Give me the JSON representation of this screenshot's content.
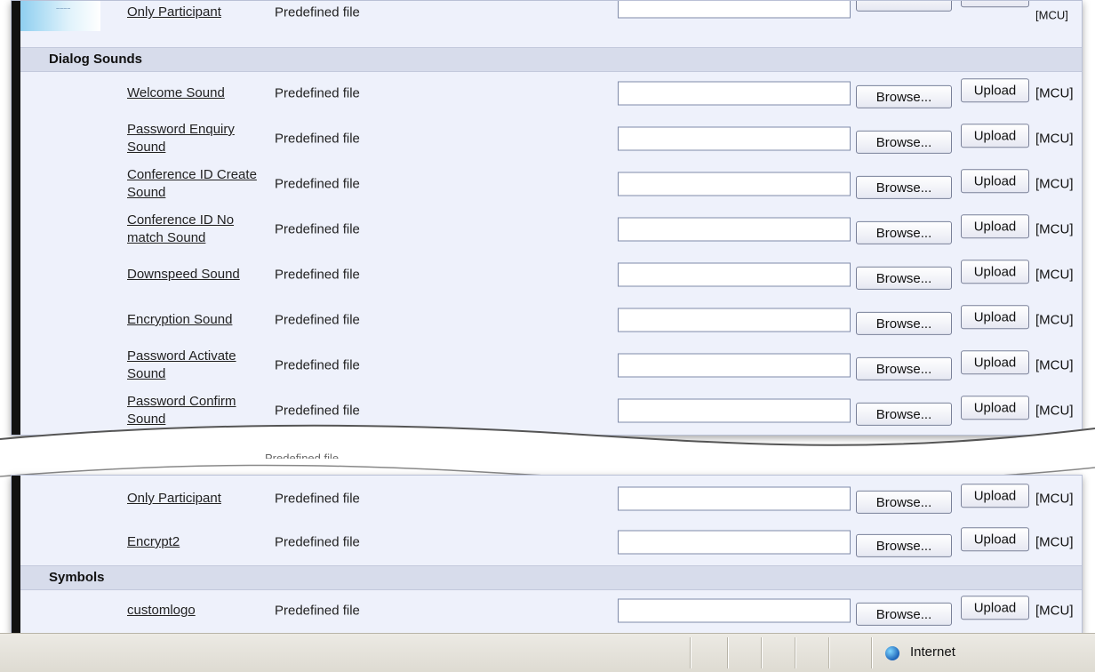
{
  "top_panel": {
    "partial_row": {
      "label": "Only Participant",
      "type": "Predefined file",
      "suffix": "[MCU]"
    },
    "section_title": "Dialog Sounds",
    "rows": [
      {
        "label": "Welcome Sound",
        "type": "Predefined file",
        "browse": "Browse...",
        "upload": "Upload",
        "suffix": "[MCU]"
      },
      {
        "label": "Password Enquiry Sound",
        "type": "Predefined file",
        "browse": "Browse...",
        "upload": "Upload",
        "suffix": "[MCU]"
      },
      {
        "label": "Conference ID Create Sound",
        "type": "Predefined file",
        "browse": "Browse...",
        "upload": "Upload",
        "suffix": "[MCU]"
      },
      {
        "label": "Conference ID No match Sound",
        "type": "Predefined file",
        "browse": "Browse...",
        "upload": "Upload",
        "suffix": "[MCU]"
      },
      {
        "label": "Downspeed Sound",
        "type": "Predefined file",
        "browse": "Browse...",
        "upload": "Upload",
        "suffix": "[MCU]"
      },
      {
        "label": "Encryption Sound",
        "type": "Predefined file",
        "browse": "Browse...",
        "upload": "Upload",
        "suffix": "[MCU]"
      },
      {
        "label": "Password Activate Sound",
        "type": "Predefined file",
        "browse": "Browse...",
        "upload": "Upload",
        "suffix": "[MCU]"
      },
      {
        "label": "Password Confirm Sound",
        "type": "Predefined file",
        "browse": "Browse...",
        "upload": "Upload",
        "suffix": "[MCU]"
      }
    ]
  },
  "bottom_panel": {
    "rows": [
      {
        "label": "Only Participant",
        "type": "Predefined file",
        "browse": "Browse...",
        "upload": "Upload",
        "suffix": "[MCU]"
      },
      {
        "label": "Encrypt2",
        "type": "Predefined file",
        "browse": "Browse...",
        "upload": "Upload",
        "suffix": "[MCU]"
      }
    ],
    "section_title": "Symbols",
    "symbol_rows": [
      {
        "label": "customlogo",
        "type": "Predefined file",
        "browse": "Browse...",
        "upload": "Upload",
        "suffix": "[MCU]"
      }
    ]
  },
  "statusbar": {
    "zone_icon": "globe-icon",
    "zone_text": "Internet"
  }
}
